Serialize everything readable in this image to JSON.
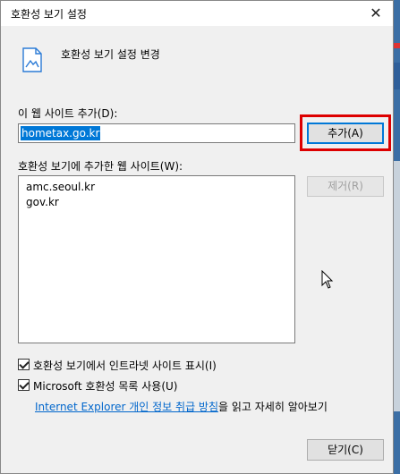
{
  "window": {
    "title": "호환성 보기 설정",
    "close_glyph": "✕"
  },
  "header": {
    "text": "호환성 보기 설정 변경",
    "icon": "page-icon"
  },
  "add_site": {
    "label": "이 웹 사이트 추가(D):",
    "value": "hometax.go.kr",
    "add_button": "추가(A)"
  },
  "sites": {
    "label": "호환성 보기에 추가한 웹 사이트(W):",
    "items": [
      "amc.seoul.kr",
      "gov.kr"
    ],
    "remove_button": "제거(R)"
  },
  "options": {
    "intranet_label": "호환성 보기에서 인트라넷 사이트 표시(I)",
    "intranet_checked": true,
    "ms_list_label": "Microsoft 호환성 목록 사용(U)",
    "ms_list_checked": true
  },
  "privacy": {
    "link_text": "Internet Explorer 개인 정보 취급 방침",
    "suffix": "을 읽고 자세히 알아보기"
  },
  "footer": {
    "close_button": "닫기(C)"
  },
  "colors": {
    "highlight": "#dd0000",
    "link": "#0066cc",
    "selection": "#0078d7"
  }
}
